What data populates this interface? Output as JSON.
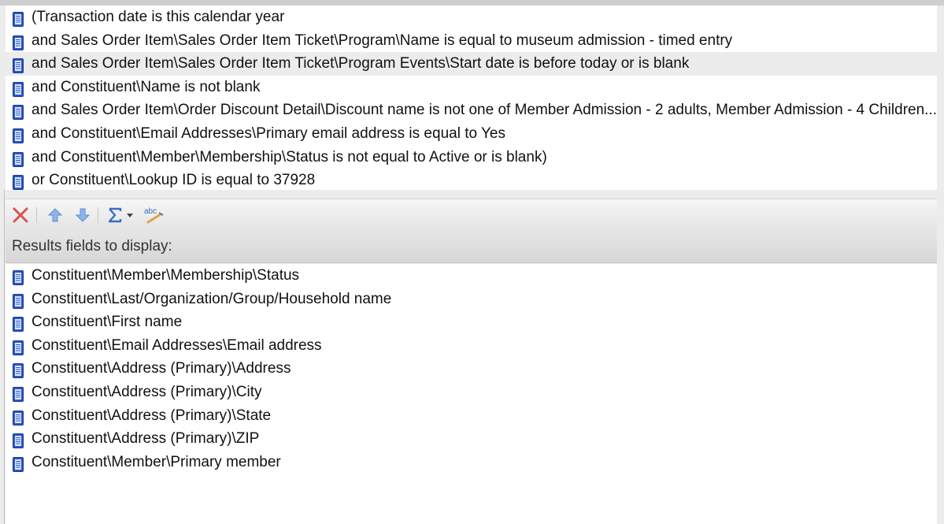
{
  "criteria": {
    "rows": [
      {
        "text": "(Transaction date is this calendar year"
      },
      {
        "text": "and Sales Order Item\\Sales Order Item Ticket\\Program\\Name is equal to museum admission - timed entry"
      },
      {
        "text": "and Sales Order Item\\Sales Order Item Ticket\\Program Events\\Start date is before today or is blank"
      },
      {
        "text": "and Constituent\\Name is not blank"
      },
      {
        "text": "and Sales Order Item\\Order Discount Detail\\Discount name is not one of Member Admission - 2 adults, Member Admission - 4 Children..."
      },
      {
        "text": "and Constituent\\Email Addresses\\Primary email address is equal to Yes"
      },
      {
        "text": "and Constituent\\Member\\Membership\\Status is not equal to Active or is blank)"
      },
      {
        "text": "or Constituent\\Lookup ID is equal to 37928"
      }
    ],
    "selected_index": 2
  },
  "toolbar": {
    "buttons": [
      {
        "icon": "delete-x-icon"
      },
      {
        "icon": "move-up-arrow-icon"
      },
      {
        "icon": "move-down-arrow-icon"
      },
      {
        "icon": "sigma-summarize-icon"
      },
      {
        "icon": "spellcheck-abc-icon"
      }
    ],
    "colors": {
      "delete": "#d9534f",
      "arrow": "#5a8fd6",
      "sigma": "#3b6cc4"
    }
  },
  "results": {
    "header": "Results fields to display:",
    "rows": [
      {
        "text": "Constituent\\Member\\Membership\\Status"
      },
      {
        "text": "Constituent\\Last/Organization/Group/Household name"
      },
      {
        "text": "Constituent\\First name"
      },
      {
        "text": "Constituent\\Email Addresses\\Email address"
      },
      {
        "text": "Constituent\\Address (Primary)\\Address"
      },
      {
        "text": "Constituent\\Address (Primary)\\City"
      },
      {
        "text": "Constituent\\Address (Primary)\\State"
      },
      {
        "text": "Constituent\\Address (Primary)\\ZIP"
      },
      {
        "text": "Constituent\\Member\\Primary member"
      }
    ]
  },
  "row_icon": "field-document-icon"
}
